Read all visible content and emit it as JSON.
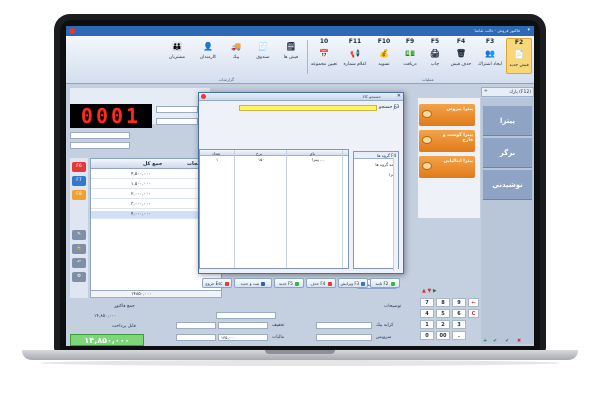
{
  "window": {
    "title": "فاكتور فروش - حالت تقاضا"
  },
  "ribbon": {
    "buttons": [
      {
        "key": "F2",
        "label": "فيش جديد"
      },
      {
        "key": "F3",
        "label": "ايجاد اشتراك"
      },
      {
        "key": "F4",
        "label": "حذف فيش"
      },
      {
        "key": "F5",
        "label": "چاپ"
      },
      {
        "key": "F9",
        "label": "دريافت"
      },
      {
        "key": "F10",
        "label": "تسويه"
      },
      {
        "key": "F11",
        "label": "اعلام شماره"
      },
      {
        "key": "10",
        "label": "تعيين مجموعه"
      },
      {
        "key": "",
        "label": "فيش ها"
      },
      {
        "key": "",
        "label": "صندوق"
      },
      {
        "key": "",
        "label": "پيك"
      },
      {
        "key": "",
        "label": "كارمندان"
      },
      {
        "key": "",
        "label": "مشتريان"
      }
    ],
    "group_labels": [
      "عمليات",
      "گزارشات"
    ]
  },
  "nav": {
    "label": "پارك (F12)"
  },
  "categories": [
    "پيتزا",
    "برگر",
    "نوشيدني"
  ],
  "items": [
    {
      "name": "پيتزا پپرونی"
    },
    {
      "name": "پيتزا گوشت و قارچ"
    },
    {
      "name": "پيتزا ايتاليايي"
    }
  ],
  "counter": {
    "value": "0001"
  },
  "grid": {
    "headers": [
      "جمع كل",
      "توضيحات"
    ],
    "rows": [
      {
        "total": "۴,۵۰۰,۰۰۰",
        "note": ""
      },
      {
        "total": "۱,۵۰۰,۰۰۰",
        "note": ""
      },
      {
        "total": "۲,۰۰۰,۰۰۰",
        "note": ""
      },
      {
        "total": "۳,۰۰۰,۰۰۰",
        "note": ""
      },
      {
        "total": "۴,۰۰۰,۰۰۰",
        "note": ""
      }
    ],
    "sum": "۱۴۸۵۰,۰۰۰"
  },
  "side_icons": [
    "F6",
    "F7",
    "F8"
  ],
  "bottom": {
    "label_sum": "جمع فاكتور",
    "label_paid": "قابل پرداخت",
    "label_desc": "توضيحات",
    "label_discount": "تخفيف",
    "label_tax": "ماليات",
    "label_service": "سرويس",
    "label_price": "كرايه پيك",
    "value_sum": "۱۴,۸۵۰,۰۰۰",
    "value_discount": "۱۳۵,۰۰۰",
    "final_total": "۱۴,۸۵۰,۰۰۰"
  },
  "keypad": [
    "7",
    "8",
    "9",
    "4",
    "5",
    "6",
    "1",
    "2",
    "3",
    "0",
    "00",
    "."
  ],
  "modal": {
    "title": "جستجو كالا",
    "search_label": "جستجو F3",
    "table_headers": [
      "تعداد",
      "نرخ",
      "نام"
    ],
    "table_row": {
      "qty": "۱",
      "rate": "۱۵۰",
      "name": "پيتزا ..."
    },
    "tree_header": "گروه ها F4",
    "tree_items": [
      "همه گروه ها",
      "پيتزا"
    ],
    "buttons": [
      {
        "label": "تاييد F2",
        "dot": "#3bb54a"
      },
      {
        "label": "ويرايش F3",
        "dot": "#3478c8"
      },
      {
        "label": "حذف F4",
        "dot": "#e53935"
      },
      {
        "label": "جديد F5",
        "dot": "#3bb54a"
      },
      {
        "label": "ثبت و جديد",
        "dot": "#2b63b0"
      },
      {
        "label": "خروج Esc",
        "dot": "#e53935"
      }
    ]
  },
  "colors": {
    "accent": "#2e69b5",
    "item_orange": "#e07b19",
    "counter_red": "#ff2a1a",
    "total_green": "#7ed67a"
  }
}
